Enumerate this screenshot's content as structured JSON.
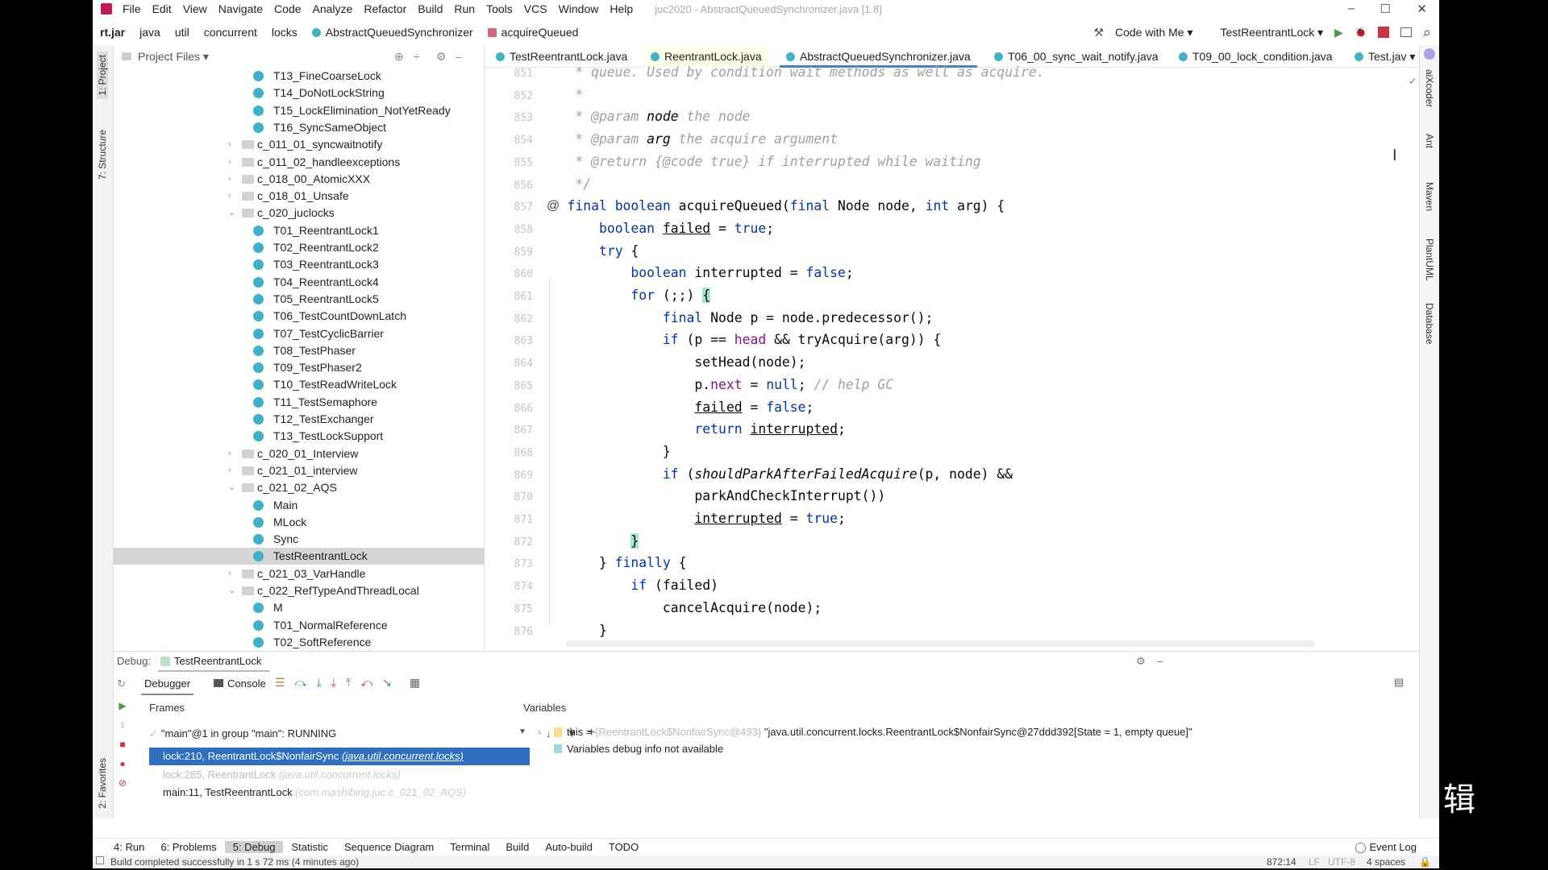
{
  "menu": {
    "items": [
      "File",
      "Edit",
      "View",
      "Navigate",
      "Code",
      "Analyze",
      "Refactor",
      "Build",
      "Run",
      "Tools",
      "VCS",
      "Window",
      "Help"
    ],
    "title": "juc2020 - AbstractQueuedSynchronizer.java [1.8]"
  },
  "window": {
    "minimize": "–",
    "maximize": "☐",
    "close": "✕"
  },
  "breadcrumb": [
    "rt.jar",
    "java",
    "util",
    "concurrent",
    "locks",
    "AbstractQueuedSynchronizer",
    "acquireQueued"
  ],
  "toolbar": {
    "code_with_me": "Code with Me ▾",
    "run_config": "TestReentrantLock ▾",
    "hammer": "⚒",
    "run": "▶",
    "debug": "🐞",
    "search": "⌕"
  },
  "left_strip": {
    "project": "1: Project",
    "structure": "7: Structure",
    "favorites": "2: Favorites"
  },
  "right_strip": [
    "aiXcoder",
    "Ant",
    "Maven",
    "PlantUML",
    "Database"
  ],
  "project": {
    "title": "Project Files ▾",
    "items": [
      {
        "label": "T13_FineCoarseLock",
        "type": "class"
      },
      {
        "label": "T14_DoNotLockString",
        "type": "class"
      },
      {
        "label": "T15_LockElimination_NotYetReady",
        "type": "class"
      },
      {
        "label": "T16_SyncSameObject",
        "type": "class"
      },
      {
        "label": "c_011_01_syncwaitnotify",
        "type": "folder",
        "open": false
      },
      {
        "label": "c_011_02_handleexceptions",
        "type": "folder",
        "open": false
      },
      {
        "label": "c_018_00_AtomicXXX",
        "type": "folder",
        "open": false
      },
      {
        "label": "c_018_01_Unsafe",
        "type": "folder",
        "open": false
      },
      {
        "label": "c_020_juclocks",
        "type": "folder",
        "open": true
      },
      {
        "label": "T01_ReentrantLock1",
        "type": "class"
      },
      {
        "label": "T02_ReentrantLock2",
        "type": "class"
      },
      {
        "label": "T03_ReentrantLock3",
        "type": "class"
      },
      {
        "label": "T04_ReentrantLock4",
        "type": "class"
      },
      {
        "label": "T05_ReentrantLock5",
        "type": "class"
      },
      {
        "label": "T06_TestCountDownLatch",
        "type": "class"
      },
      {
        "label": "T07_TestCyclicBarrier",
        "type": "class"
      },
      {
        "label": "T08_TestPhaser",
        "type": "class"
      },
      {
        "label": "T09_TestPhaser2",
        "type": "class"
      },
      {
        "label": "T10_TestReadWriteLock",
        "type": "class"
      },
      {
        "label": "T11_TestSemaphore",
        "type": "class"
      },
      {
        "label": "T12_TestExchanger",
        "type": "class"
      },
      {
        "label": "T13_TestLockSupport",
        "type": "class"
      },
      {
        "label": "c_020_01_Interview",
        "type": "folder",
        "open": false
      },
      {
        "label": "c_021_01_interview",
        "type": "folder",
        "open": false
      },
      {
        "label": "c_021_02_AQS",
        "type": "folder",
        "open": true
      },
      {
        "label": "Main",
        "type": "class"
      },
      {
        "label": "MLock",
        "type": "class"
      },
      {
        "label": "Sync",
        "type": "class"
      },
      {
        "label": "TestReentrantLock",
        "type": "class",
        "selected": true
      },
      {
        "label": "c_021_03_VarHandle",
        "type": "folder",
        "open": false
      },
      {
        "label": "c_022_RefTypeAndThreadLocal",
        "type": "folder",
        "open": true
      },
      {
        "label": "M",
        "type": "class"
      },
      {
        "label": "T01_NormalReference",
        "type": "class"
      },
      {
        "label": "T02_SoftReference",
        "type": "class"
      }
    ]
  },
  "editor_tabs": [
    {
      "label": "TestReentrantLock.java"
    },
    {
      "label": "ReentrantLock.java",
      "modified": true
    },
    {
      "label": "AbstractQueuedSynchronizer.java",
      "active": true
    },
    {
      "label": "T06_00_sync_wait_notify.java"
    },
    {
      "label": "T09_00_lock_condition.java"
    },
    {
      "label": "Test.jav ▾"
    }
  ],
  "editor": {
    "first_line": 851,
    "override_marker": "@",
    "lines": [
      [
        [
          "     * queue. Used by condition wait methods as well as acquire.",
          "c"
        ]
      ],
      [
        [
          "     *",
          "c"
        ]
      ],
      [
        [
          "     * @param ",
          "c"
        ],
        [
          "node",
          "i"
        ],
        [
          " the node",
          "c"
        ]
      ],
      [
        [
          "     * @param ",
          "c"
        ],
        [
          "arg",
          "i"
        ],
        [
          " the acquire argument",
          "c"
        ]
      ],
      [
        [
          "     * @return {@code true} if interrupted while waiting",
          "c"
        ]
      ],
      [
        [
          "     */",
          "c"
        ]
      ],
      [
        [
          "    "
        ],
        [
          "final boolean ",
          "k"
        ],
        [
          "acquireQueued("
        ],
        [
          "final ",
          "k"
        ],
        [
          "Node node, "
        ],
        [
          "int ",
          "k"
        ],
        [
          "arg) {"
        ]
      ],
      [
        [
          "        "
        ],
        [
          "boolean ",
          "k"
        ],
        [
          "failed",
          "u"
        ],
        [
          " = "
        ],
        [
          "true",
          "k"
        ],
        [
          ";"
        ]
      ],
      [
        [
          "        "
        ],
        [
          "try ",
          "k"
        ],
        [
          "{"
        ]
      ],
      [
        [
          "            "
        ],
        [
          "boolean ",
          "k"
        ],
        [
          "interrupted = "
        ],
        [
          "false",
          "k"
        ],
        [
          ";"
        ]
      ],
      [
        [
          "            "
        ],
        [
          "for ",
          "k"
        ],
        [
          "(;;) "
        ],
        [
          "{",
          "m"
        ]
      ],
      [
        [
          "                "
        ],
        [
          "final ",
          "k"
        ],
        [
          "Node p = node.predecessor();"
        ]
      ],
      [
        [
          "                "
        ],
        [
          "if ",
          "k"
        ],
        [
          "(p == "
        ],
        [
          "head",
          "f"
        ],
        [
          " && tryAcquire(arg)) {"
        ]
      ],
      [
        [
          "                    setHead(node);"
        ]
      ],
      [
        [
          "                    p."
        ],
        [
          "next",
          "f"
        ],
        [
          " = "
        ],
        [
          "null",
          "k"
        ],
        [
          "; "
        ],
        [
          "// help GC",
          "c"
        ]
      ],
      [
        [
          "                    "
        ],
        [
          "failed",
          "u"
        ],
        [
          " = "
        ],
        [
          "false",
          "k"
        ],
        [
          ";"
        ]
      ],
      [
        [
          "                    "
        ],
        [
          "return ",
          "k"
        ],
        [
          "interrupted",
          "u"
        ],
        [
          ";"
        ]
      ],
      [
        [
          "                }"
        ]
      ],
      [
        [
          "                "
        ],
        [
          "if ",
          "k"
        ],
        [
          "("
        ],
        [
          "shouldParkAfterFailedAcquire",
          "i"
        ],
        [
          "(p, node) &&"
        ]
      ],
      [
        [
          "                    parkAndCheckInterrupt())"
        ]
      ],
      [
        [
          "                    "
        ],
        [
          "interrupted",
          "u"
        ],
        [
          " = "
        ],
        [
          "true",
          "k"
        ],
        [
          ";"
        ]
      ],
      [
        [
          "            "
        ],
        [
          "}",
          "m"
        ]
      ],
      [
        [
          "        } "
        ],
        [
          "finally ",
          "k"
        ],
        [
          "{"
        ]
      ],
      [
        [
          "            "
        ],
        [
          "if ",
          "k"
        ],
        [
          "(failed)"
        ]
      ],
      [
        [
          "                cancelAcquire(node);"
        ]
      ],
      [
        [
          "        }"
        ]
      ]
    ]
  },
  "debug": {
    "label": "Debug:",
    "session": "TestReentrantLock",
    "tabs": [
      "Debugger",
      "Console"
    ],
    "frames_title": "Frames",
    "variables_title": "Variables",
    "thread": "\"main\"@1 in group \"main\": RUNNING",
    "frames": [
      {
        "method": "lock:210, ReentrantLock$NonfairSync",
        "pkg": "(java.util.concurrent.locks)",
        "selected": true
      },
      {
        "method": "lock:285, ReentrantLock",
        "pkg": "(java.util.concurrent.locks)",
        "dim": true
      },
      {
        "method": "main:11, TestReentrantLock",
        "pkg": "(com.mashibing.juc.c_021_02_AQS)"
      }
    ],
    "variables": [
      {
        "name": "this = ",
        "ref": "{ReentrantLock$NonfairSync@493}",
        "value": "\"java.util.concurrent.locks.ReentrantLock$NonfairSync@27ddd392[State = 1, empty queue]\""
      },
      {
        "name": "Variables debug info not available"
      }
    ]
  },
  "bottom_tabs": [
    {
      "label": "4: Run"
    },
    {
      "label": "6: Problems"
    },
    {
      "label": "5: Debug",
      "active": true
    },
    {
      "label": "Statistic"
    },
    {
      "label": "Sequence Diagram"
    },
    {
      "label": "Terminal"
    },
    {
      "label": "Build"
    },
    {
      "label": "Auto-build"
    },
    {
      "label": "TODO"
    }
  ],
  "event_log": "Event Log",
  "status": {
    "message": "Build completed successfully in 1 s 72 ms (4 minutes ago)",
    "position": "872:14",
    "line_sep": "LF",
    "encoding": "UTF-8",
    "indent": "4 spaces"
  },
  "caption": "辑"
}
